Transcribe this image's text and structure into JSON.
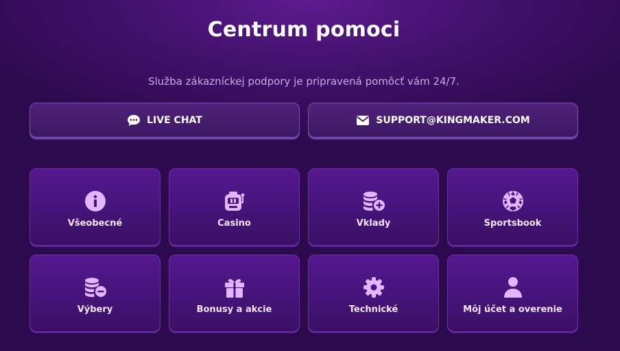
{
  "page": {
    "title": "Centrum pomoci",
    "subtitle": "Služba zákazníckej podpory je pripravená pomôcť vám 24/7."
  },
  "contact": {
    "live_chat_label": "LIVE CHAT",
    "live_chat_icon": "chat-bubble-icon",
    "email_label": "SUPPORT@KINGMAKER.COM",
    "email_icon": "envelope-icon"
  },
  "categories": [
    {
      "label": "Všeobecné",
      "icon": "info-icon"
    },
    {
      "label": "Casino",
      "icon": "slot-machine-icon"
    },
    {
      "label": "Vklady",
      "icon": "coins-plus-icon"
    },
    {
      "label": "Sportsbook",
      "icon": "soccer-ball-icon"
    },
    {
      "label": "Výbery",
      "icon": "coins-minus-icon"
    },
    {
      "label": "Bonusy a akcie",
      "icon": "gift-icon"
    },
    {
      "label": "Technické",
      "icon": "gear-icon"
    },
    {
      "label": "Môj účet a overenie",
      "icon": "user-icon"
    }
  ],
  "colors": {
    "accent_icon": "#e3b6ff",
    "background": "#3f1068",
    "card": "#4a1480"
  }
}
